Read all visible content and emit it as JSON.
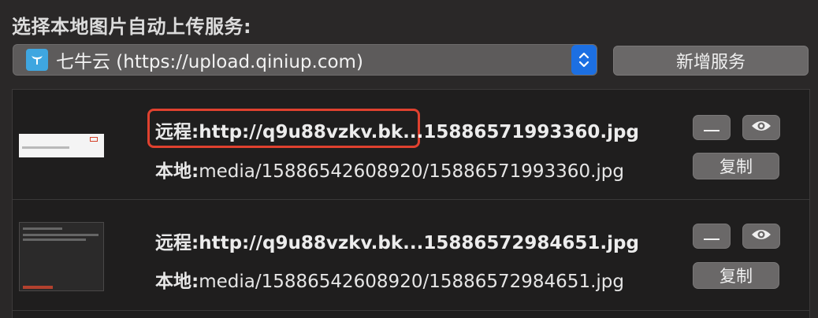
{
  "heading": "选择本地图片自动上传服务:",
  "service_select": {
    "selected": "七牛云 (https://upload.qiniup.com)",
    "icon": "qiniu-logo-icon",
    "stepper_icon": "chevron-up-down-icon"
  },
  "add_service_label": "新增服务",
  "items": [
    {
      "remote_label": "远程:",
      "remote_url": "http://q9u88vzkv.bk...15886571993360.jpg",
      "local_label": "本地:",
      "local_path": "media/15886542608920/15886571993360.jpg",
      "copy_label": "复制",
      "thumbnail": "screenshot-thumbnail-white"
    },
    {
      "remote_label": "远程:",
      "remote_url": "http://q9u88vzkv.bk...15886572984651.jpg",
      "local_label": "本地:",
      "local_path": "media/15886542608920/15886572984651.jpg",
      "copy_label": "复制",
      "thumbnail": "screenshot-thumbnail-dark"
    }
  ],
  "colors": {
    "accent": "#1c6fe2",
    "highlight": "#e0412f",
    "service_icon": "#3fa6e0"
  }
}
